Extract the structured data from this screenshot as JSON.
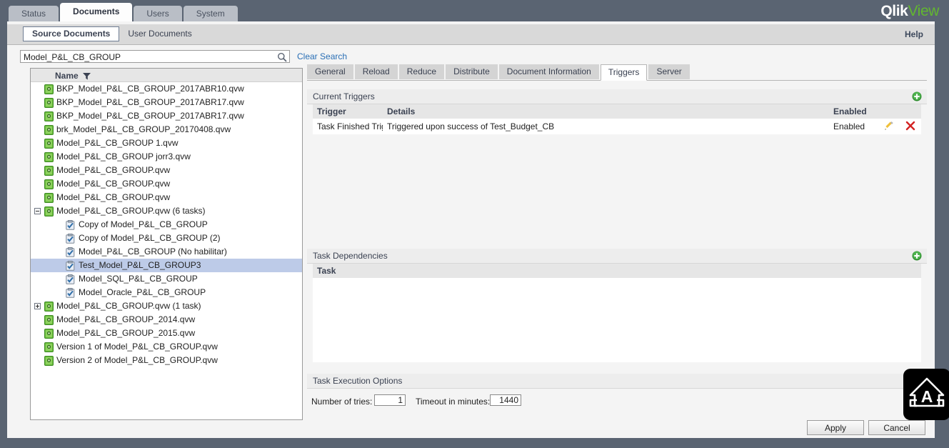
{
  "app": {
    "logo_primary": "Qlik",
    "logo_secondary": "View",
    "accent_green": "#63b730",
    "frame_color": "#5a6472",
    "link_color": "#2a6fb5",
    "selection_color": "#bdcbe8"
  },
  "main_nav": {
    "tabs": [
      {
        "label": "Status",
        "active": false
      },
      {
        "label": "Documents",
        "active": true
      },
      {
        "label": "Users",
        "active": false
      },
      {
        "label": "System",
        "active": false
      }
    ]
  },
  "sub_nav": {
    "tabs": [
      {
        "label": "Source Documents",
        "active": true
      },
      {
        "label": "User Documents",
        "active": false
      }
    ],
    "help_label": "Help"
  },
  "search": {
    "value": "Model_P&L_CB_GROUP",
    "placeholder": "",
    "icon": "search-icon",
    "clear_label": "Clear Search"
  },
  "document_list": {
    "column_header": "Name",
    "filter_icon": "funnel-icon",
    "rows": [
      {
        "label": "BKP_Model_P&L_CB_GROUP_2017ABR10.qvw",
        "level": 0,
        "icon": "document-icon",
        "twisty": "none",
        "selected": false
      },
      {
        "label": "BKP_Model_P&L_CB_GROUP_2017ABR17.qvw",
        "level": 0,
        "icon": "document-icon",
        "twisty": "none",
        "selected": false
      },
      {
        "label": "BKP_Model_P&L_CB_GROUP_2017ABR17.qvw",
        "level": 0,
        "icon": "document-icon",
        "twisty": "none",
        "selected": false
      },
      {
        "label": "brk_Model_P&L_CB_GROUP_20170408.qvw",
        "level": 0,
        "icon": "document-icon",
        "twisty": "none",
        "selected": false
      },
      {
        "label": "Model_P&L_CB_GROUP 1.qvw",
        "level": 0,
        "icon": "document-icon",
        "twisty": "none",
        "selected": false
      },
      {
        "label": "Model_P&L_CB_GROUP jorr3.qvw",
        "level": 0,
        "icon": "document-icon",
        "twisty": "none",
        "selected": false
      },
      {
        "label": "Model_P&L_CB_GROUP.qvw",
        "level": 0,
        "icon": "document-icon",
        "twisty": "none",
        "selected": false
      },
      {
        "label": "Model_P&L_CB_GROUP.qvw",
        "level": 0,
        "icon": "document-icon",
        "twisty": "none",
        "selected": false
      },
      {
        "label": "Model_P&L_CB_GROUP.qvw",
        "level": 0,
        "icon": "document-icon",
        "twisty": "none",
        "selected": false
      },
      {
        "label": "Model_P&L_CB_GROUP.qvw (6 tasks)",
        "level": 0,
        "icon": "document-icon",
        "twisty": "minus",
        "selected": false
      },
      {
        "label": "Copy of Model_P&L_CB_GROUP",
        "level": 1,
        "icon": "task-icon",
        "twisty": "none",
        "selected": false
      },
      {
        "label": "Copy of Model_P&L_CB_GROUP (2)",
        "level": 1,
        "icon": "task-icon",
        "twisty": "none",
        "selected": false
      },
      {
        "label": "Model_P&L_CB_GROUP (No habilitar)",
        "level": 1,
        "icon": "task-icon",
        "twisty": "none",
        "selected": false
      },
      {
        "label": "Test_Model_P&L_CB_GROUP3",
        "level": 1,
        "icon": "task-icon",
        "twisty": "none",
        "selected": true
      },
      {
        "label": "Model_SQL_P&L_CB_GROUP",
        "level": 1,
        "icon": "task-icon",
        "twisty": "none",
        "selected": false
      },
      {
        "label": "Model_Oracle_P&L_CB_GROUP",
        "level": 1,
        "icon": "task-icon",
        "twisty": "none",
        "selected": false
      },
      {
        "label": "Model_P&L_CB_GROUP.qvw (1 task)",
        "level": 0,
        "icon": "document-icon",
        "twisty": "plus",
        "selected": false
      },
      {
        "label": "Model_P&L_CB_GROUP_2014.qvw",
        "level": 0,
        "icon": "document-icon",
        "twisty": "none",
        "selected": false
      },
      {
        "label": "Model_P&L_CB_GROUP_2015.qvw",
        "level": 0,
        "icon": "document-icon",
        "twisty": "none",
        "selected": false
      },
      {
        "label": "Version 1 of Model_P&L_CB_GROUP.qvw",
        "level": 0,
        "icon": "document-icon",
        "twisty": "none",
        "selected": false
      },
      {
        "label": "Version 2 of Model_P&L_CB_GROUP.qvw",
        "level": 0,
        "icon": "document-icon",
        "twisty": "none",
        "selected": false
      }
    ]
  },
  "detail_tabs": [
    {
      "label": "General",
      "active": false
    },
    {
      "label": "Reload",
      "active": false
    },
    {
      "label": "Reduce",
      "active": false
    },
    {
      "label": "Distribute",
      "active": false
    },
    {
      "label": "Document Information",
      "active": false
    },
    {
      "label": "Triggers",
      "active": true
    },
    {
      "label": "Server",
      "active": false
    }
  ],
  "current_triggers": {
    "title": "Current Triggers",
    "add_icon": "add-icon",
    "columns": [
      "Trigger",
      "Details",
      "Enabled"
    ],
    "rows": [
      {
        "trigger": "Task Finished Trigge",
        "details": "Triggered upon success of Test_Budget_CB",
        "enabled": "Enabled",
        "edit_icon": "edit-pencil-icon",
        "delete_icon": "delete-x-icon"
      }
    ]
  },
  "task_dependencies": {
    "title": "Task Dependencies",
    "add_icon": "add-icon",
    "columns": [
      "Task"
    ],
    "rows": []
  },
  "task_execution_options": {
    "title": "Task Execution Options",
    "number_of_tries_label": "Number of tries:",
    "number_of_tries_value": "1",
    "timeout_label": "Timeout in minutes:",
    "timeout_value": "1440"
  },
  "footer_buttons": {
    "apply_label": "Apply",
    "cancel_label": "Cancel"
  },
  "overlay_badge": {
    "icon": "home-letter-a-icon"
  }
}
